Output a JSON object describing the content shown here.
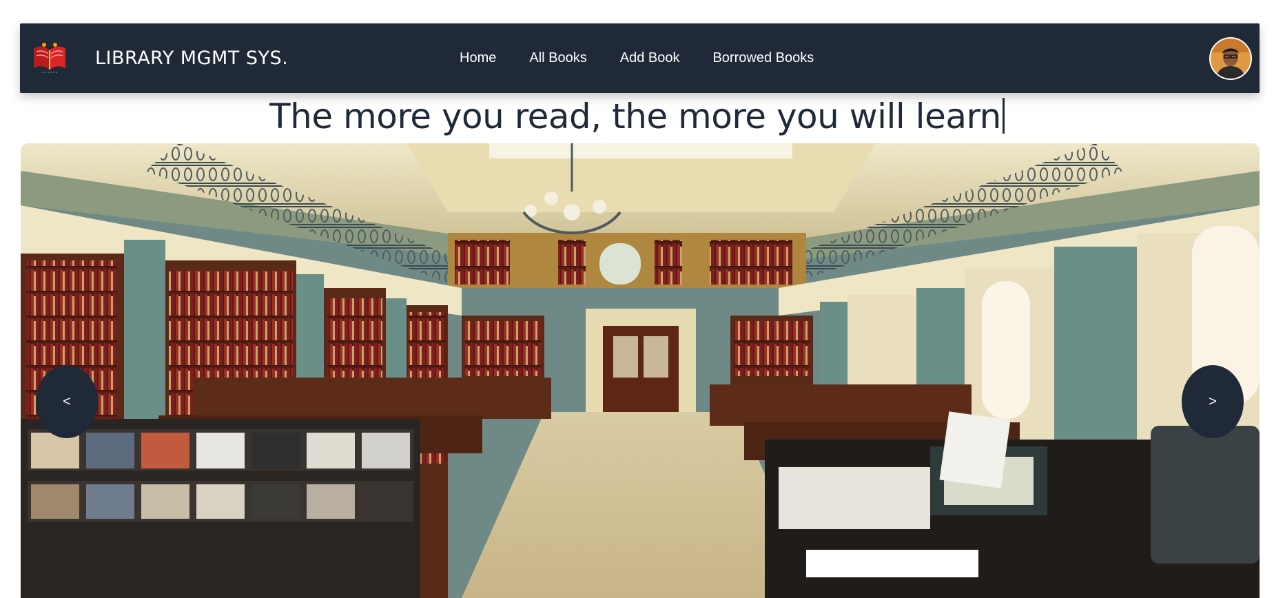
{
  "header": {
    "brand": "LIBRARY MGMT SYS.",
    "logo_icon": "book-logo-icon",
    "avatar_icon": "user-avatar",
    "nav": [
      {
        "label": "Home"
      },
      {
        "label": "All Books"
      },
      {
        "label": "Add Book"
      },
      {
        "label": "Borrowed Books"
      }
    ]
  },
  "hero": {
    "tagline": "The more you read, the more you will learn",
    "prev_label": "<",
    "next_label": ">"
  },
  "colors": {
    "navbar": "#1f2937",
    "text": "#1f2937",
    "button": "#1f2937"
  }
}
